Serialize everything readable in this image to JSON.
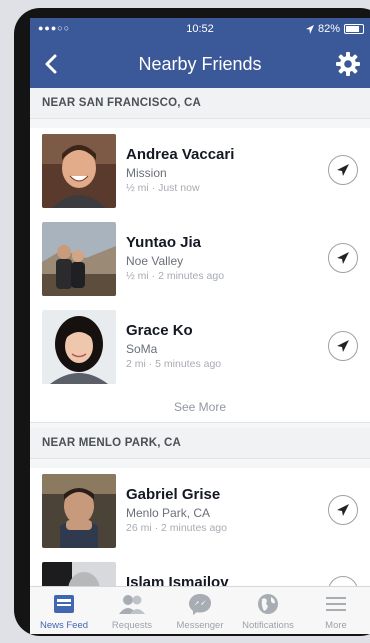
{
  "status_bar": {
    "signal": "●●●○○",
    "time": "10:52",
    "battery": "82%"
  },
  "nav": {
    "title": "Nearby Friends"
  },
  "sections": [
    {
      "header": "NEAR SAN FRANCISCO, CA",
      "friends": [
        {
          "name": "Andrea Vaccari",
          "location": "Mission",
          "meta": "½ mi · Just now"
        },
        {
          "name": "Yuntao Jia",
          "location": "Noe Valley",
          "meta": "½ mi · 2 minutes ago"
        },
        {
          "name": "Grace Ko",
          "location": "SoMa",
          "meta": "2 mi · 5 minutes ago"
        }
      ],
      "see_more": "See More"
    },
    {
      "header": "NEAR MENLO PARK, CA",
      "friends": [
        {
          "name": "Gabriel Grise",
          "location": "Menlo Park, CA",
          "meta": "26 mi · 2 minutes ago"
        },
        {
          "name": "Islam Ismailov",
          "location": "",
          "meta": ""
        }
      ]
    }
  ],
  "tabs": [
    {
      "label": "News Feed",
      "icon": "news-feed-icon",
      "active": true
    },
    {
      "label": "Requests",
      "icon": "requests-icon",
      "active": false
    },
    {
      "label": "Messenger",
      "icon": "messenger-icon",
      "active": false
    },
    {
      "label": "Notifications",
      "icon": "globe-icon",
      "active": false
    },
    {
      "label": "More",
      "icon": "menu-icon",
      "active": false
    }
  ],
  "colors": {
    "brand": "#3b5998",
    "active_tab": "#4267b2"
  }
}
